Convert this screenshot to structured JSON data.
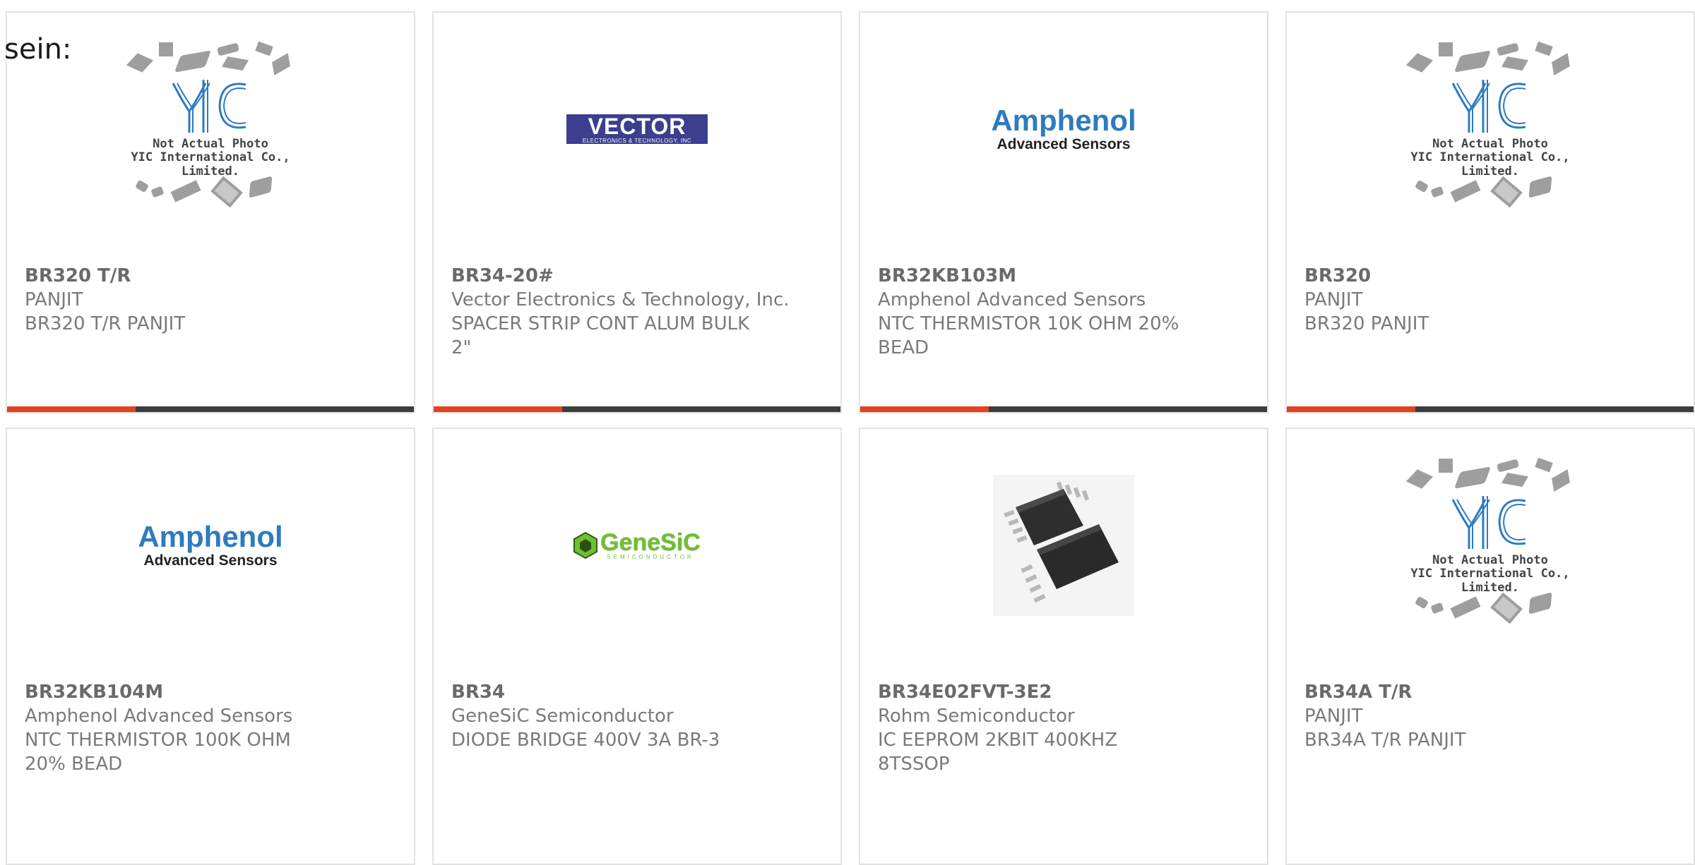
{
  "lead_text": "sein:",
  "brand": {
    "accent": "#e5401f",
    "bar": "#3d3d3d"
  },
  "placeholder": {
    "line1": "Not Actual Photo",
    "line2": "YIC International Co., Limited."
  },
  "logos": {
    "vector_main": "VECTOR",
    "vector_sub": "ELECTRONICS & TECHNOLOGY, INC",
    "amphenol_main": "Amphenol",
    "amphenol_sub": "Advanced Sensors",
    "genesic_main": "GeneSiC",
    "genesic_sub": "SEMICONDUCTOR"
  },
  "products": [
    {
      "part": "BR320 T/R",
      "manufacturer": "PANJIT",
      "description": "BR320 T/R PANJIT",
      "image": "yic-placeholder"
    },
    {
      "part": "BR34-20#",
      "manufacturer": "Vector Electronics & Technology, Inc.",
      "description": "SPACER STRIP CONT ALUM BULK 2\"",
      "image": "vector-logo"
    },
    {
      "part": "BR32KB103M",
      "manufacturer": "Amphenol Advanced Sensors",
      "description": "NTC THERMISTOR 10K OHM 20% BEAD",
      "image": "amphenol-logo"
    },
    {
      "part": "BR320",
      "manufacturer": "PANJIT",
      "description": "BR320 PANJIT",
      "image": "yic-placeholder"
    },
    {
      "part": "BR32KB104M",
      "manufacturer": "Amphenol Advanced Sensors",
      "description": "NTC THERMISTOR 100K OHM 20% BEAD",
      "image": "amphenol-logo"
    },
    {
      "part": "BR34",
      "manufacturer": "GeneSiC Semiconductor",
      "description": "DIODE BRIDGE 400V 3A BR-3",
      "image": "genesic-logo"
    },
    {
      "part": "BR34E02FVT-3E2",
      "manufacturer": "Rohm Semiconductor",
      "description": "IC EEPROM 2KBIT 400KHZ 8TSSOP",
      "image": "chip-photo"
    },
    {
      "part": "BR34A T/R",
      "manufacturer": "PANJIT",
      "description": "BR34A T/R PANJIT",
      "image": "yic-placeholder"
    }
  ]
}
